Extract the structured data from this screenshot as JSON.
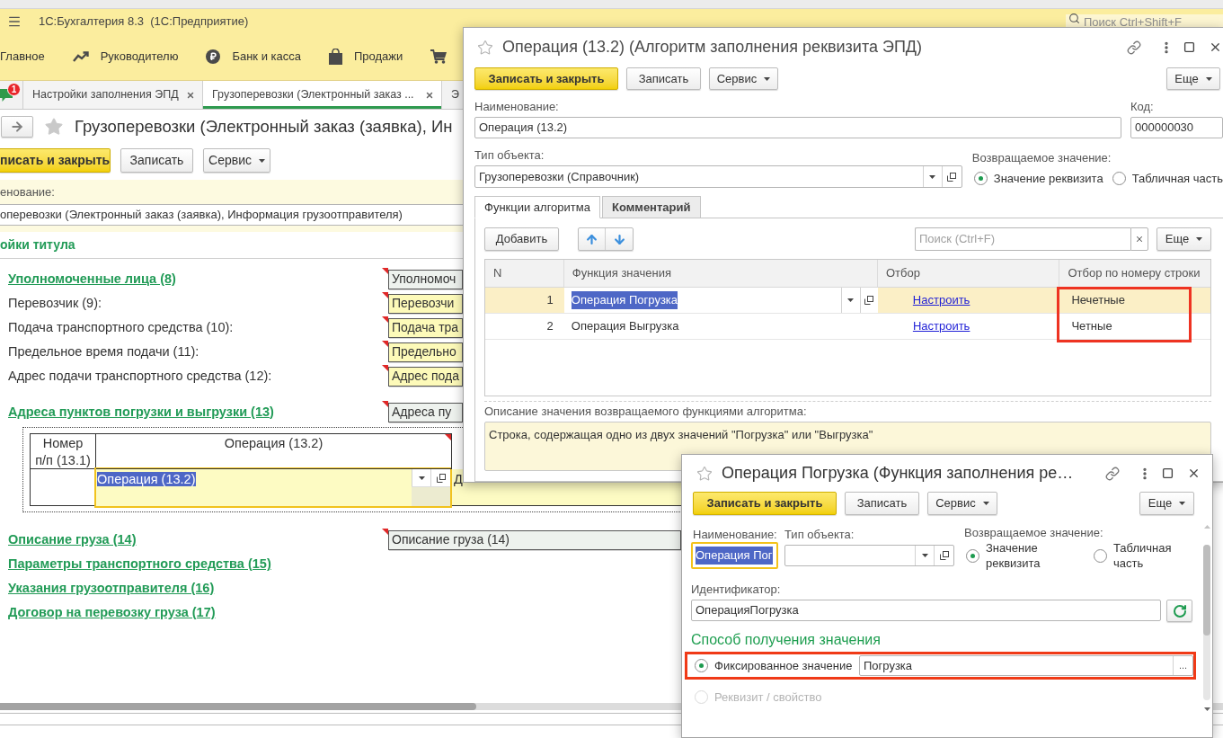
{
  "app_bar": {
    "title": "1С:Бухгалтерия 8.3  (1С:Предприятие)",
    "search": {
      "placeholder": "Поиск Ctrl+Shift+F"
    }
  },
  "sections": [
    "Главное",
    "Руководителю",
    "Банк и касса",
    "Продажи"
  ],
  "open_tabs": {
    "notification_count": "1",
    "tabs": [
      {
        "label": "Настройки заполнения ЭПД",
        "selected": false
      },
      {
        "label": "Грузоперевозки (Электронный заказ ...",
        "selected": true
      }
    ],
    "next_tab": "Э"
  },
  "form": {
    "title": "Грузоперевозки (Электронный заказ (заявка), Ин",
    "buttons": [
      {
        "label": "писать и закрыть",
        "kind": "primary"
      },
      {
        "label": "Записать",
        "kind": "plain"
      },
      {
        "label": "Сервис",
        "kind": "menu"
      }
    ],
    "name_field": {
      "label": "енование:",
      "value": "оперевозки (Электронный заказ (заявка), Информация грузоотправителя)"
    },
    "section_title": "ойки титула",
    "rows": [
      {
        "kind": "group",
        "label": "Уполномоченные лица (8)",
        "field": "Уполномоч"
      },
      {
        "kind": "item",
        "label": "Перевозчик (9):",
        "field": "Перевозчи"
      },
      {
        "kind": "item",
        "label": "Подача транспортного средства (10):",
        "field": "Подача тра"
      },
      {
        "kind": "item",
        "label": "Предельное время подачи (11):",
        "field": "Предельно"
      },
      {
        "kind": "item",
        "label": "Адрес подачи транспортного средства (12):",
        "field": "Адрес пода"
      },
      {
        "kind": "group",
        "label": "Адреса пунктов погрузки и выгрузки (13)",
        "field": "Адреса пу"
      },
      {
        "kind": "table",
        "columns": [
          "Номер\nп/п (13.1)",
          "Операция (13.2)"
        ],
        "rows": [
          {
            "operation": "Операция (13.2)",
            "focused": true,
            "column_3": "Д"
          }
        ]
      },
      {
        "kind": "group",
        "label": "Описание груза (14)",
        "field": "Описание груза (14)"
      },
      {
        "kind": "group",
        "label": "Параметры транспортного средства (15)"
      },
      {
        "kind": "group",
        "label": "Указания грузоотправителя (16)"
      },
      {
        "kind": "group",
        "label": "Договор на перевозку груза (17)"
      }
    ]
  },
  "dialog_algorithm": {
    "title": "Операция (13.2) (Алгоритм заполнения реквизита ЭПД)",
    "buttons": [
      {
        "label": "Записать и закрыть",
        "kind": "primary"
      },
      {
        "label": "Записать",
        "kind": "plain"
      },
      {
        "label": "Сервис",
        "kind": "menu"
      }
    ],
    "more_button": "Еще",
    "name": {
      "label": "Наименование:",
      "value": "Операция (13.2)"
    },
    "code": {
      "label": "Код:",
      "value": "000000030"
    },
    "object_type": {
      "label": "Тип объекта:",
      "value": "Грузоперевозки (Справочник)"
    },
    "return_value": {
      "label": "Возвращаемое значение:",
      "options": [
        {
          "label": "Значение реквизита",
          "selected": true
        },
        {
          "label": "Табличная часть",
          "selected": false
        }
      ]
    },
    "tabs": [
      {
        "label": "Функции алгоритма",
        "selected": true
      },
      {
        "label": "Комментарий",
        "selected": false
      }
    ],
    "toolbar": {
      "add_button": "Добавить",
      "search": {
        "placeholder": "Поиск (Ctrl+F)"
      },
      "more_button": "Еще"
    },
    "table": {
      "columns": [
        "N",
        "Функция значения",
        "Отбор",
        "Отбор по номеру строки"
      ],
      "rows": [
        {
          "n": "1",
          "function": "Операция Погрузка",
          "filter": "Настроить",
          "row_filter": "Нечетные",
          "selected": true
        },
        {
          "n": "2",
          "function": "Операция Выгрузка",
          "filter": "Настроить",
          "row_filter": "Четные",
          "selected": false
        }
      ],
      "row_filter_marked": true
    },
    "description": {
      "label": "Описание значения возвращаемого функциями алгоритма:",
      "value": "Строка, содержащая одно из двух значений \"Погрузка\" или \"Выгрузка\""
    }
  },
  "dialog_function": {
    "title": "Операция Погрузка (Функция заполнения ре…",
    "buttons": [
      {
        "label": "Записать и закрыть",
        "kind": "primary"
      },
      {
        "label": "Записать",
        "kind": "plain"
      },
      {
        "label": "Сервис",
        "kind": "menu"
      }
    ],
    "more_button": "Еще",
    "name": {
      "label": "Наименование:",
      "value": "Операция Пог",
      "focused": true
    },
    "object_type": {
      "label": "Тип объекта:"
    },
    "return_value": {
      "label": "Возвращаемое значение:",
      "options": [
        {
          "label": "Значение реквизита",
          "selected": true
        },
        {
          "label": "Табличная часть",
          "selected": false
        }
      ]
    },
    "identifier": {
      "label": "Идентификатор:",
      "value": "ОперацияПогрузка"
    },
    "method": {
      "title": "Способ получения значения",
      "options": [
        {
          "label": "Фиксированное значение",
          "selected": true,
          "disabled": false,
          "marked": true,
          "value": "Погрузка",
          "select_button": "..."
        },
        {
          "label": "Реквизит / свойство",
          "selected": false,
          "disabled": true,
          "marked": false
        }
      ]
    }
  }
}
